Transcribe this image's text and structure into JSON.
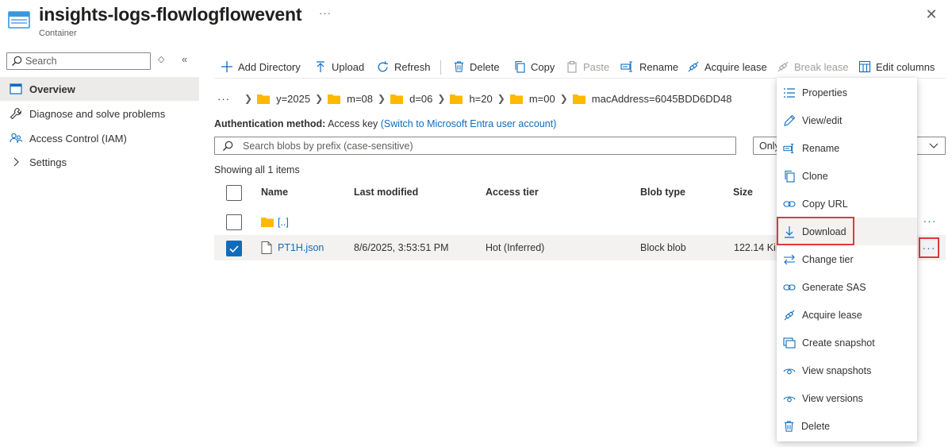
{
  "header": {
    "title": "insights-logs-flowlogflowevent",
    "subtitle": "Container",
    "more": "···",
    "close": "✕"
  },
  "nav": {
    "search_placeholder": "Search",
    "toggle": "◇",
    "collapse": "«",
    "items": [
      {
        "label": "Overview",
        "icon": "overview-icon",
        "active": true
      },
      {
        "label": "Diagnose and solve problems",
        "icon": "wrench-icon"
      },
      {
        "label": "Access Control (IAM)",
        "icon": "people-icon"
      },
      {
        "label": "Settings",
        "icon": "chevron-right-icon"
      }
    ]
  },
  "toolbar": {
    "add_directory": "Add Directory",
    "upload": "Upload",
    "refresh": "Refresh",
    "delete": "Delete",
    "copy": "Copy",
    "paste": "Paste",
    "rename": "Rename",
    "acquire_lease": "Acquire lease",
    "break_lease": "Break lease",
    "edit_columns": "Edit columns"
  },
  "breadcrumb": {
    "ellipsis": "···",
    "items": [
      "y=2025",
      "m=08",
      "d=06",
      "h=20",
      "m=00",
      "macAddress=6045BDD6DD48"
    ]
  },
  "auth": {
    "label": "Authentication method:",
    "value": "Access key",
    "link": "(Switch to Microsoft Entra user account)"
  },
  "blob_search": {
    "placeholder": "Search blobs by prefix (case-sensitive)"
  },
  "filter": {
    "value": "Only"
  },
  "summary": "Showing all 1 items",
  "table": {
    "columns": [
      "Name",
      "Last modified",
      "Access tier",
      "Blob type",
      "Size"
    ],
    "rows": [
      {
        "name": "[..]",
        "type": "folder",
        "last_modified": "",
        "access_tier": "",
        "blob_type": "",
        "size": "",
        "checked": false
      },
      {
        "name": "PT1H.json",
        "type": "file",
        "last_modified": "8/6/2025, 3:53:51 PM",
        "access_tier": "Hot (Inferred)",
        "blob_type": "Block blob",
        "size": "122.14 KiB",
        "checked": true
      }
    ],
    "row_more": "···"
  },
  "context_menu": {
    "items": [
      {
        "label": "Properties",
        "icon": "list-icon"
      },
      {
        "label": "View/edit",
        "icon": "pencil-icon"
      },
      {
        "label": "Rename",
        "icon": "rename-icon"
      },
      {
        "label": "Clone",
        "icon": "clone-icon"
      },
      {
        "label": "Copy URL",
        "icon": "link-icon"
      },
      {
        "label": "Download",
        "icon": "download-icon",
        "highlighted": true
      },
      {
        "label": "Change tier",
        "icon": "swap-icon"
      },
      {
        "label": "Generate SAS",
        "icon": "link-icon"
      },
      {
        "label": "Acquire lease",
        "icon": "lease-icon"
      },
      {
        "label": "Create snapshot",
        "icon": "snapshot-icon"
      },
      {
        "label": "View snapshots",
        "icon": "eye-icon"
      },
      {
        "label": "View versions",
        "icon": "eye-icon"
      },
      {
        "label": "Delete",
        "icon": "trash-icon"
      }
    ]
  },
  "colors": {
    "accent": "#0f6cbd",
    "folder": "#ffb900",
    "highlight_border": "#e0393e"
  }
}
